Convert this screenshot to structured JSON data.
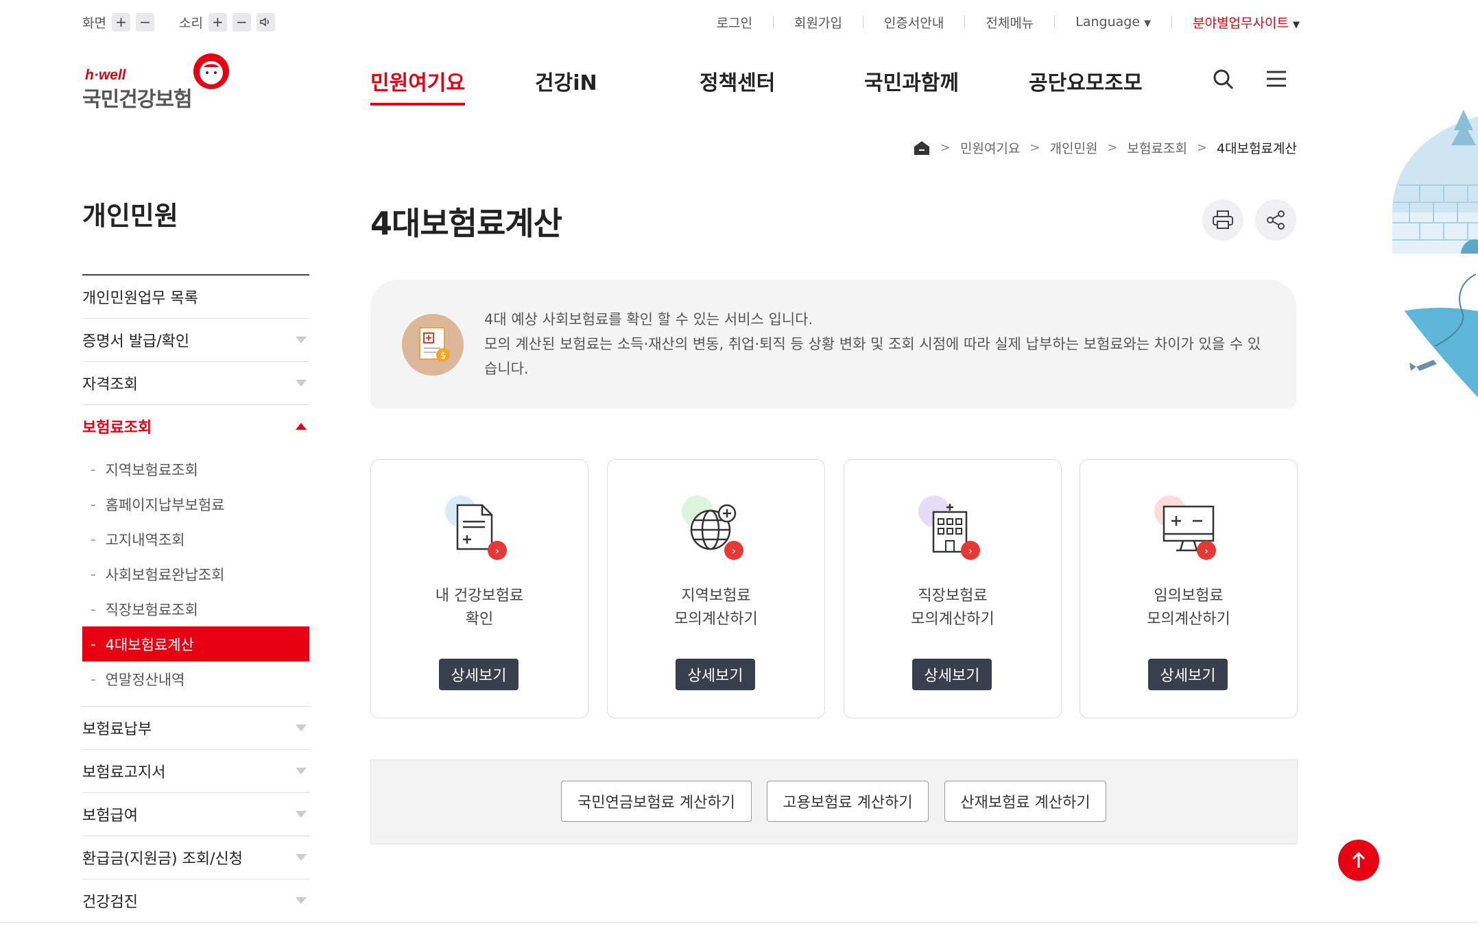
{
  "util": {
    "screen_label": "화면",
    "sound_label": "소리",
    "links": [
      "로그인",
      "회원가입",
      "인증서안내",
      "전체메뉴",
      "Language"
    ],
    "site_link": "분야별업무사이트"
  },
  "logo": {
    "tagline": "h·well",
    "name": "국민건강보험"
  },
  "gnb": [
    "민원여기요",
    "건강iN",
    "정책센터",
    "국민과함께",
    "공단요모조모"
  ],
  "breadcrumb": [
    "민원여기요",
    "개인민원",
    "보험료조회",
    "4대보험료계산"
  ],
  "lnb": {
    "title": "개인민원",
    "items": [
      "개인민원업무 목록",
      "증명서 발급/확인",
      "자격조회",
      "보험료조회",
      "보험료납부",
      "보험료고지서",
      "보험급여",
      "환급금(지원금) 조회/신청",
      "건강검진"
    ],
    "sub": [
      "지역보험료조회",
      "홈페이지납부보험료",
      "고지내역조회",
      "사회보험료완납조회",
      "직장보험료조회",
      "4대보험료계산",
      "연말정산내역"
    ]
  },
  "page": {
    "title": "4대보험료계산"
  },
  "info": {
    "line1": "4대 예상 사회보험료를 확인 할 수 있는 서비스 입니다.",
    "line2": "모의 계산된 보험료는 소득·재산의 변동, 취업·퇴직 등 상황 변화 및 조회 시점에 따라 실제 납부하는 보험료와는 차이가 있을 수 있습니다."
  },
  "cards": [
    {
      "line1": "내 건강보험료",
      "line2": "확인",
      "button": "상세보기",
      "icon": "document-plus-icon",
      "dot": "#d6ecf7"
    },
    {
      "line1": "지역보험료",
      "line2": "모의계산하기",
      "button": "상세보기",
      "icon": "globe-plus-icon",
      "dot": "#dcf3dd"
    },
    {
      "line1": "직장보험료",
      "line2": "모의계산하기",
      "button": "상세보기",
      "icon": "building-icon",
      "dot": "#e6dcf5"
    },
    {
      "line1": "임의보험료",
      "line2": "모의계산하기",
      "button": "상세보기",
      "icon": "monitor-calculator-icon",
      "dot": "#fadcdc"
    }
  ],
  "bottom_buttons": [
    "국민연금보험료 계산하기",
    "고용보험료 계산하기",
    "산재보험료 계산하기"
  ],
  "colors": {
    "accent": "#e60012",
    "dark_button": "#3a3f4d"
  }
}
